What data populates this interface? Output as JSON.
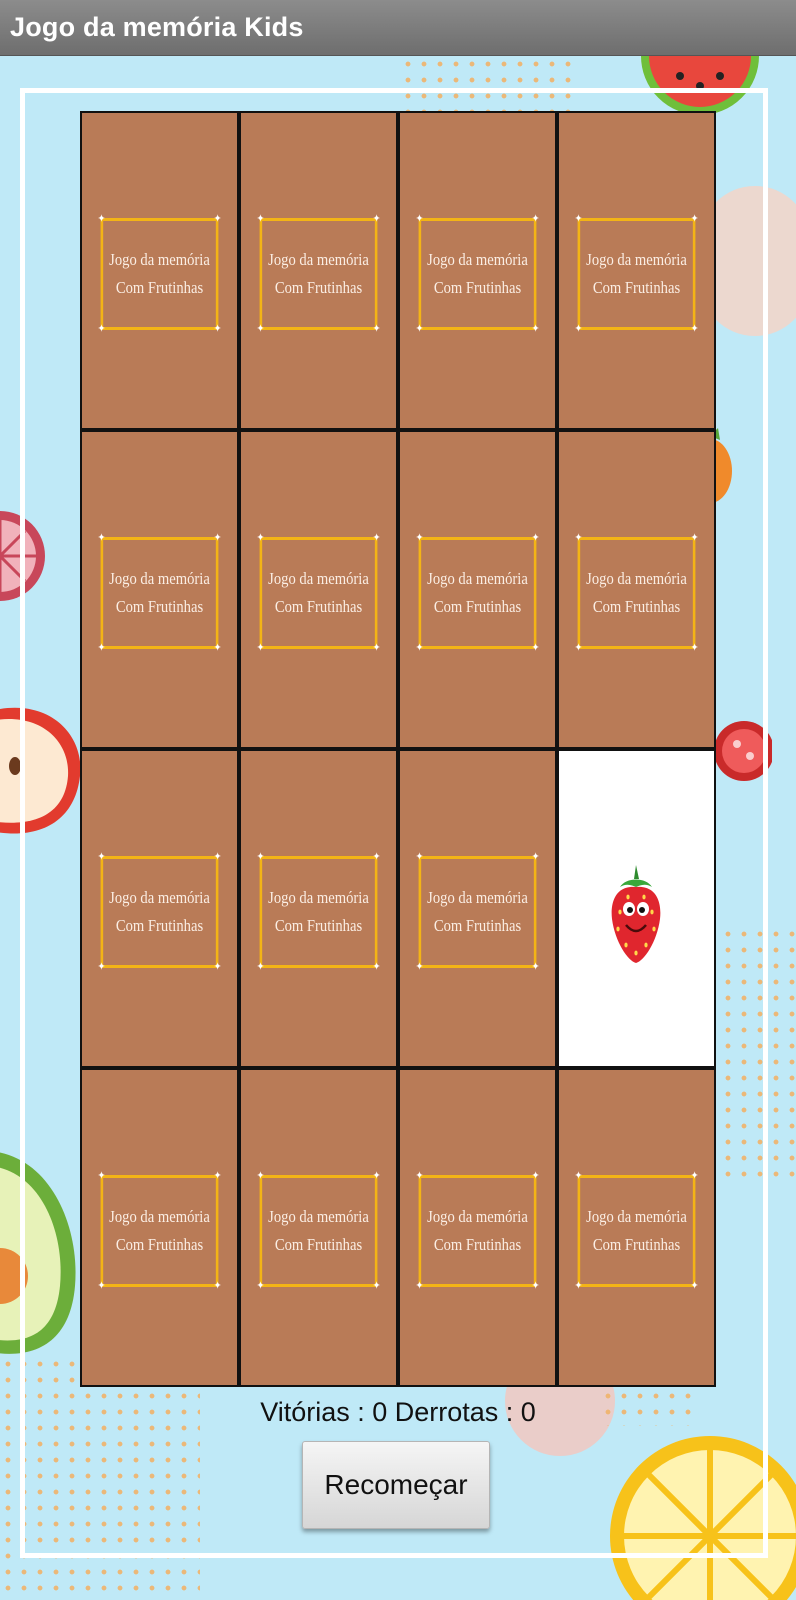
{
  "app": {
    "title": "Jogo da memória Kids"
  },
  "card_back": {
    "line1": "Jogo da memória",
    "line2": "Com Frutinhas"
  },
  "board": {
    "rows": 4,
    "columns": 4,
    "revealed_cards": [
      {
        "row": 3,
        "column": 4,
        "fruit": "strawberry-icon"
      }
    ]
  },
  "score": {
    "text": "Vitórias : 0 Derrotas : 0",
    "wins": 0,
    "losses": 0
  },
  "buttons": {
    "restart_label": "Recomeçar"
  },
  "colors": {
    "app_bar": "#7d7d7d",
    "background": "#bfe9f7",
    "card_back": "#b97b57",
    "card_border_frame": "#f3b416"
  }
}
